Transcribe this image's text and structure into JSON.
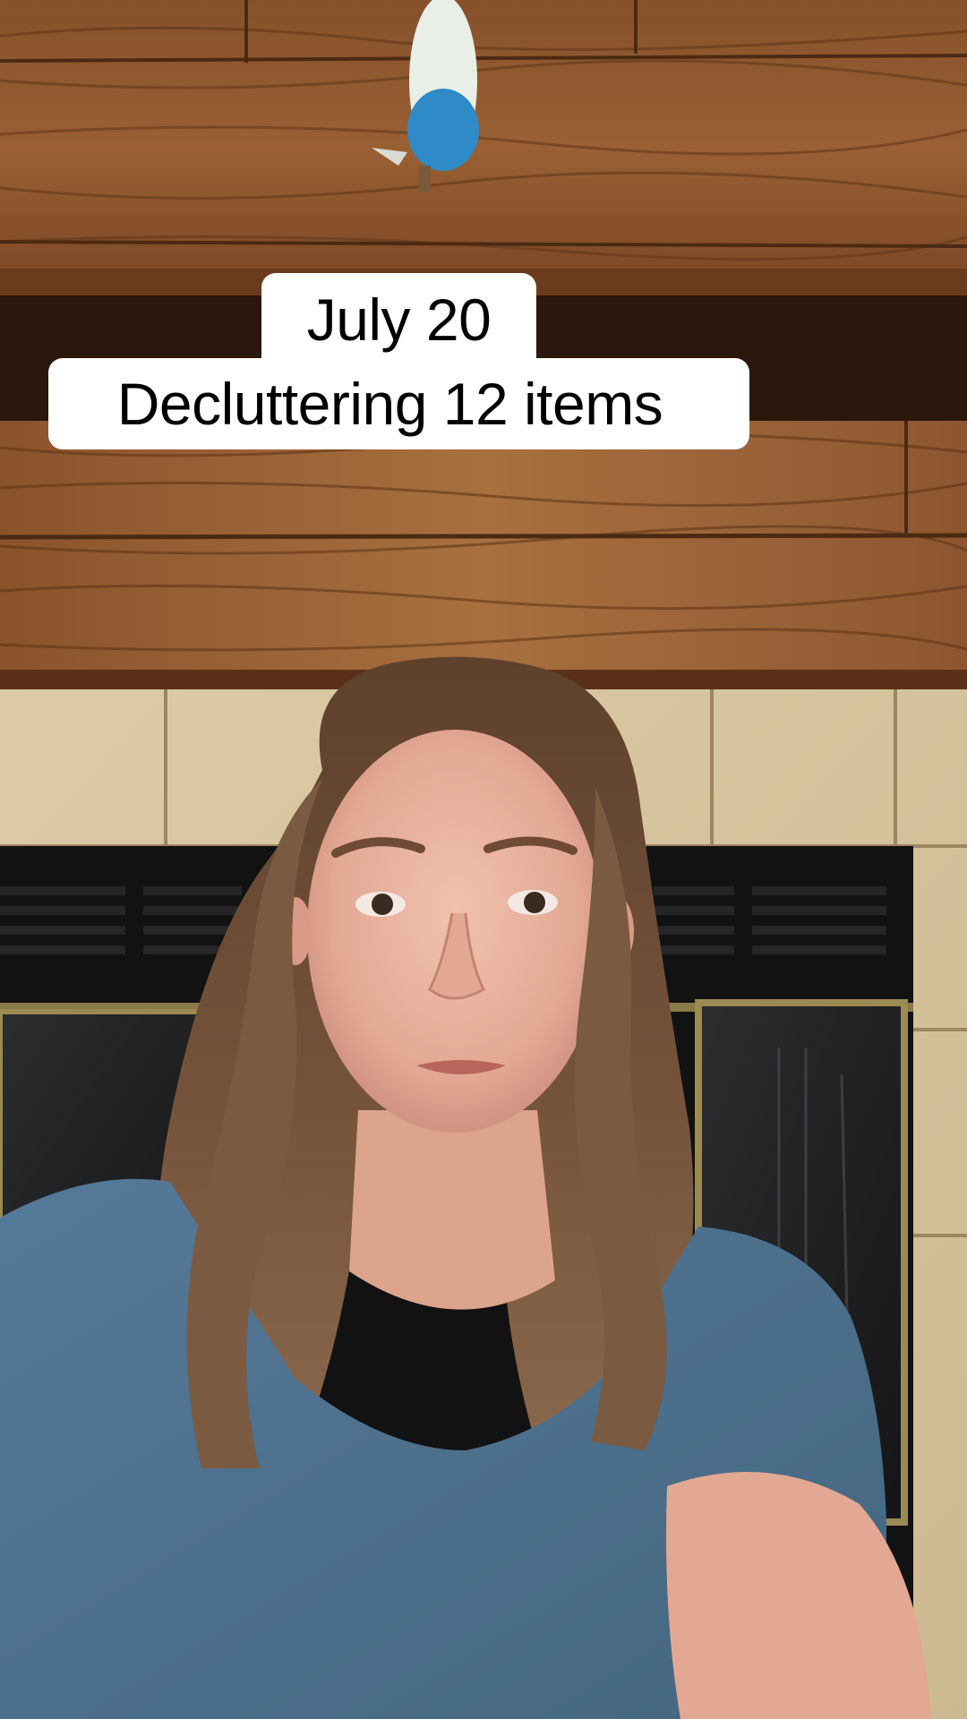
{
  "overlay": {
    "caption_line_1": "July 20",
    "caption_line_2": "Decluttering 12 items"
  },
  "colors": {
    "caption_background": "#ffffff",
    "caption_text": "#000000",
    "wood": "#7a4a28",
    "tile": "#d8c7a1",
    "shirt": "#4f7291",
    "hair": "#6b4a30"
  }
}
